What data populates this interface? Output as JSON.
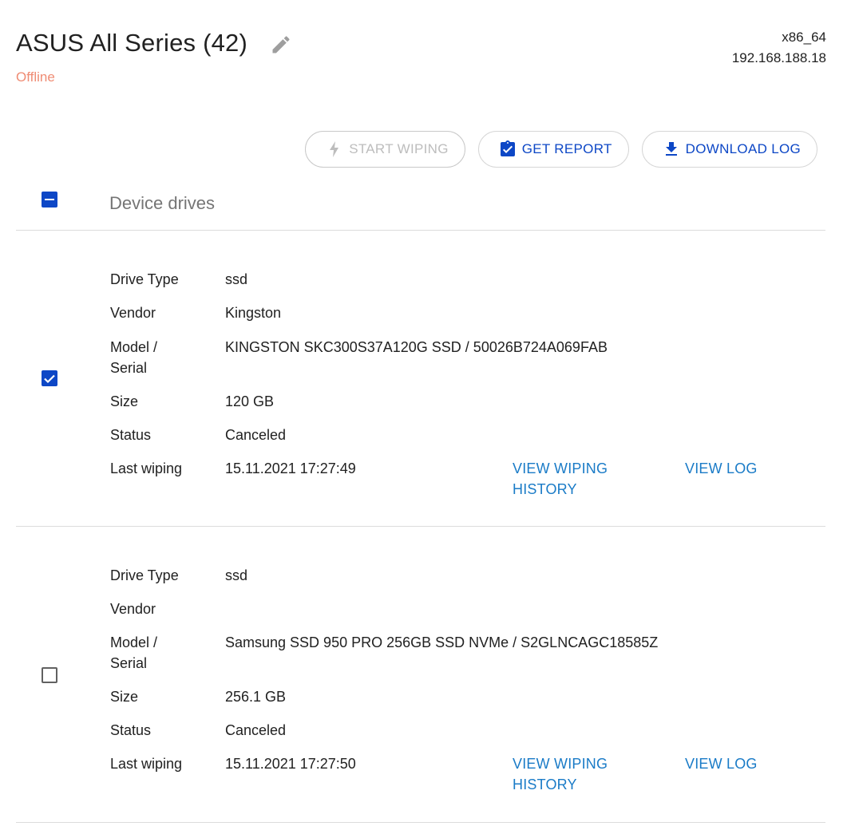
{
  "header": {
    "title": "ASUS All Series (42)",
    "status": "Offline",
    "arch": "x86_64",
    "ip": "192.168.188.18"
  },
  "toolbar": {
    "start_wiping": "START WIPING",
    "get_report": "GET REPORT",
    "download_log": "DOWNLOAD LOG"
  },
  "section": {
    "title": "Device drives"
  },
  "labels": {
    "drive_type": "Drive Type",
    "vendor": "Vendor",
    "model_serial_1": "Model /",
    "model_serial_2": "Serial",
    "size": "Size",
    "status": "Status",
    "last_wiping": "Last wiping",
    "view_wiping_history_1": "VIEW WIPING",
    "view_wiping_history_2": "HISTORY",
    "view_log": "VIEW LOG"
  },
  "drives": [
    {
      "checked": true,
      "drive_type": "ssd",
      "vendor": "Kingston",
      "model_serial": "KINGSTON SKC300S37A120G SSD / 50026B724A069FAB",
      "size": "120 GB",
      "status": "Canceled",
      "last_wiping": "15.11.2021 17:27:49"
    },
    {
      "checked": false,
      "drive_type": "ssd",
      "vendor": "",
      "model_serial": "Samsung SSD 950 PRO 256GB SSD NVMe / S2GLNCAGC18585Z",
      "size": "256.1 GB",
      "status": "Canceled",
      "last_wiping": "15.11.2021 17:27:50"
    }
  ],
  "colors": {
    "primary": "#0d47c6",
    "link": "#1a7bc7",
    "offline": "#ef8c74",
    "disabled": "#bdbdbd"
  }
}
